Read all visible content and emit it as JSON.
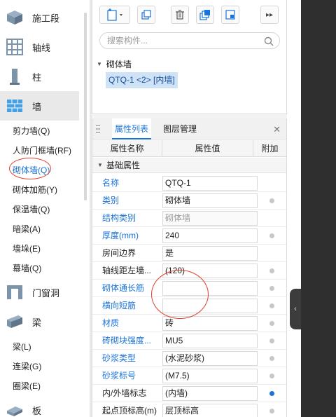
{
  "categories": [
    {
      "label": "施工段",
      "icon": "construction-zone-icon"
    },
    {
      "label": "轴线",
      "icon": "axis-grid-icon"
    },
    {
      "label": "柱",
      "icon": "column-icon"
    },
    {
      "label": "墙",
      "icon": "wall-icon"
    },
    {
      "label": "门窗洞",
      "icon": "door-window-icon"
    },
    {
      "label": "梁",
      "icon": "beam-icon"
    },
    {
      "label": "板",
      "icon": "slab-icon"
    }
  ],
  "wall_items": [
    "剪力墙(Q)",
    "人防门框墙(RF)",
    "砌体墙(Q)",
    "砌体加筋(Y)",
    "保温墙(Q)",
    "暗梁(A)",
    "墙垛(E)",
    "幕墙(Q)"
  ],
  "beam_items": [
    "梁(L)",
    "连梁(G)",
    "圈梁(E)"
  ],
  "search": {
    "placeholder": "搜索构件..."
  },
  "tree": {
    "root": "砌体墙",
    "leaf": "QTQ-1 <2> [内墙]"
  },
  "tabs": {
    "props": "属性列表",
    "layers": "图层管理"
  },
  "table": {
    "headers": {
      "name": "属性名称",
      "value": "属性值",
      "extra": "附加"
    },
    "group": "基础属性",
    "rows": [
      {
        "name": "名称",
        "value": "QTQ-1",
        "blue": true,
        "dot": ""
      },
      {
        "name": "类别",
        "value": "砌体墙",
        "blue": true,
        "dot": "gray"
      },
      {
        "name": "结构类别",
        "value": "砌体墙",
        "blue": true,
        "dot": "",
        "gray": true
      },
      {
        "name": "厚度(mm)",
        "value": "240",
        "blue": true,
        "dot": "gray"
      },
      {
        "name": "房间边界",
        "value": "是",
        "blue": false,
        "dot": ""
      },
      {
        "name": "轴线距左墙...",
        "value": "(120)",
        "blue": false,
        "dot": "gray"
      },
      {
        "name": "砌体通长筋",
        "value": "",
        "blue": true,
        "dot": "gray"
      },
      {
        "name": "横向短筋",
        "value": "",
        "blue": true,
        "dot": "gray"
      },
      {
        "name": "材质",
        "value": "砖",
        "blue": true,
        "dot": "gray"
      },
      {
        "name": "砖砌块强度...",
        "value": "MU5",
        "blue": true,
        "dot": "gray"
      },
      {
        "name": "砂浆类型",
        "value": "(水泥砂浆)",
        "blue": true,
        "dot": "gray"
      },
      {
        "name": "砂浆标号",
        "value": "(M7.5)",
        "blue": true,
        "dot": "gray"
      },
      {
        "name": "内/外墙标志",
        "value": "(内墙)",
        "blue": false,
        "dot": "blue"
      },
      {
        "name": "起点顶标高(m)",
        "value": "层顶标高",
        "blue": false,
        "dot": "gray"
      }
    ]
  }
}
